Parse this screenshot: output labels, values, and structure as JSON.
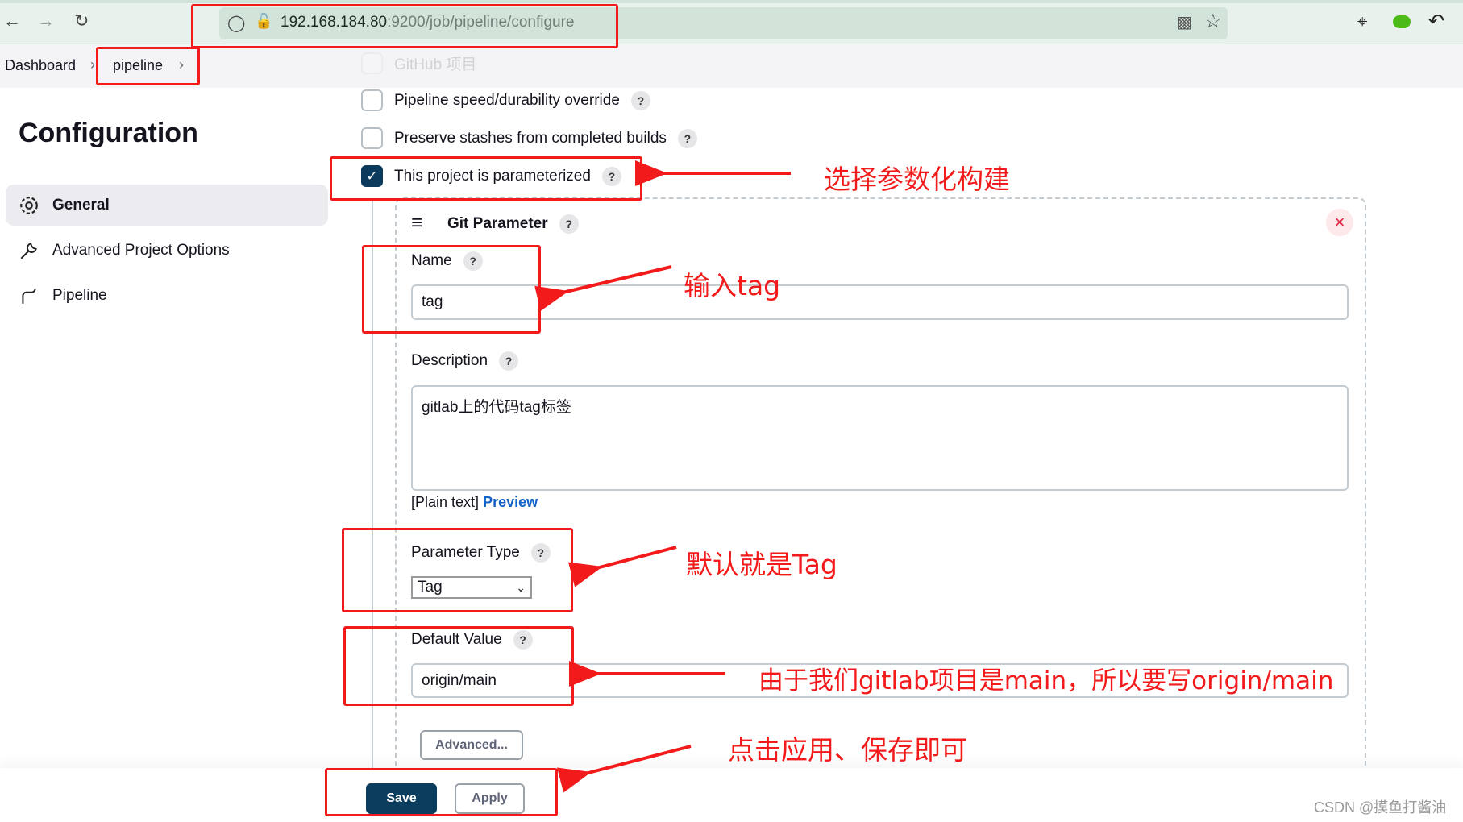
{
  "browser": {
    "url_host": "192.168.184.80",
    "url_rest": ":9200/job/pipeline/configure"
  },
  "breadcrumb": [
    {
      "label": "Dashboard"
    },
    {
      "label": "pipeline"
    }
  ],
  "page_title": "Configuration",
  "sidebar": {
    "items": [
      {
        "label": "General",
        "icon": "gear-icon",
        "active": true
      },
      {
        "label": "Advanced Project Options",
        "icon": "wrench-icon"
      },
      {
        "label": "Pipeline",
        "icon": "pipeline-icon"
      }
    ]
  },
  "options": [
    {
      "label": "GitHub 项目",
      "checked": false,
      "faded": true
    },
    {
      "label": "Pipeline speed/durability override",
      "checked": false
    },
    {
      "label": "Preserve stashes from completed builds",
      "checked": false
    },
    {
      "label": "This project is parameterized",
      "checked": true
    }
  ],
  "git_parameter": {
    "title": "Git Parameter",
    "name_label": "Name",
    "name_value": "tag",
    "description_label": "Description",
    "description_value": "gitlab上的代码tag标签",
    "plain_text": "[Plain text]",
    "preview": "Preview",
    "type_label": "Parameter Type",
    "type_value": "Tag",
    "default_label": "Default Value",
    "default_value": "origin/main",
    "advanced": "Advanced..."
  },
  "help": "?",
  "buttons": {
    "save": "Save",
    "apply": "Apply"
  },
  "annotations": {
    "param": "选择参数化构建",
    "name": "输入tag",
    "type": "默认就是Tag",
    "default": "由于我们gitlab项目是main，所以要写origin/main",
    "save": "点击应用、保存即可",
    "color": "#f21a1a"
  },
  "watermark": "CSDN @摸鱼打酱油"
}
